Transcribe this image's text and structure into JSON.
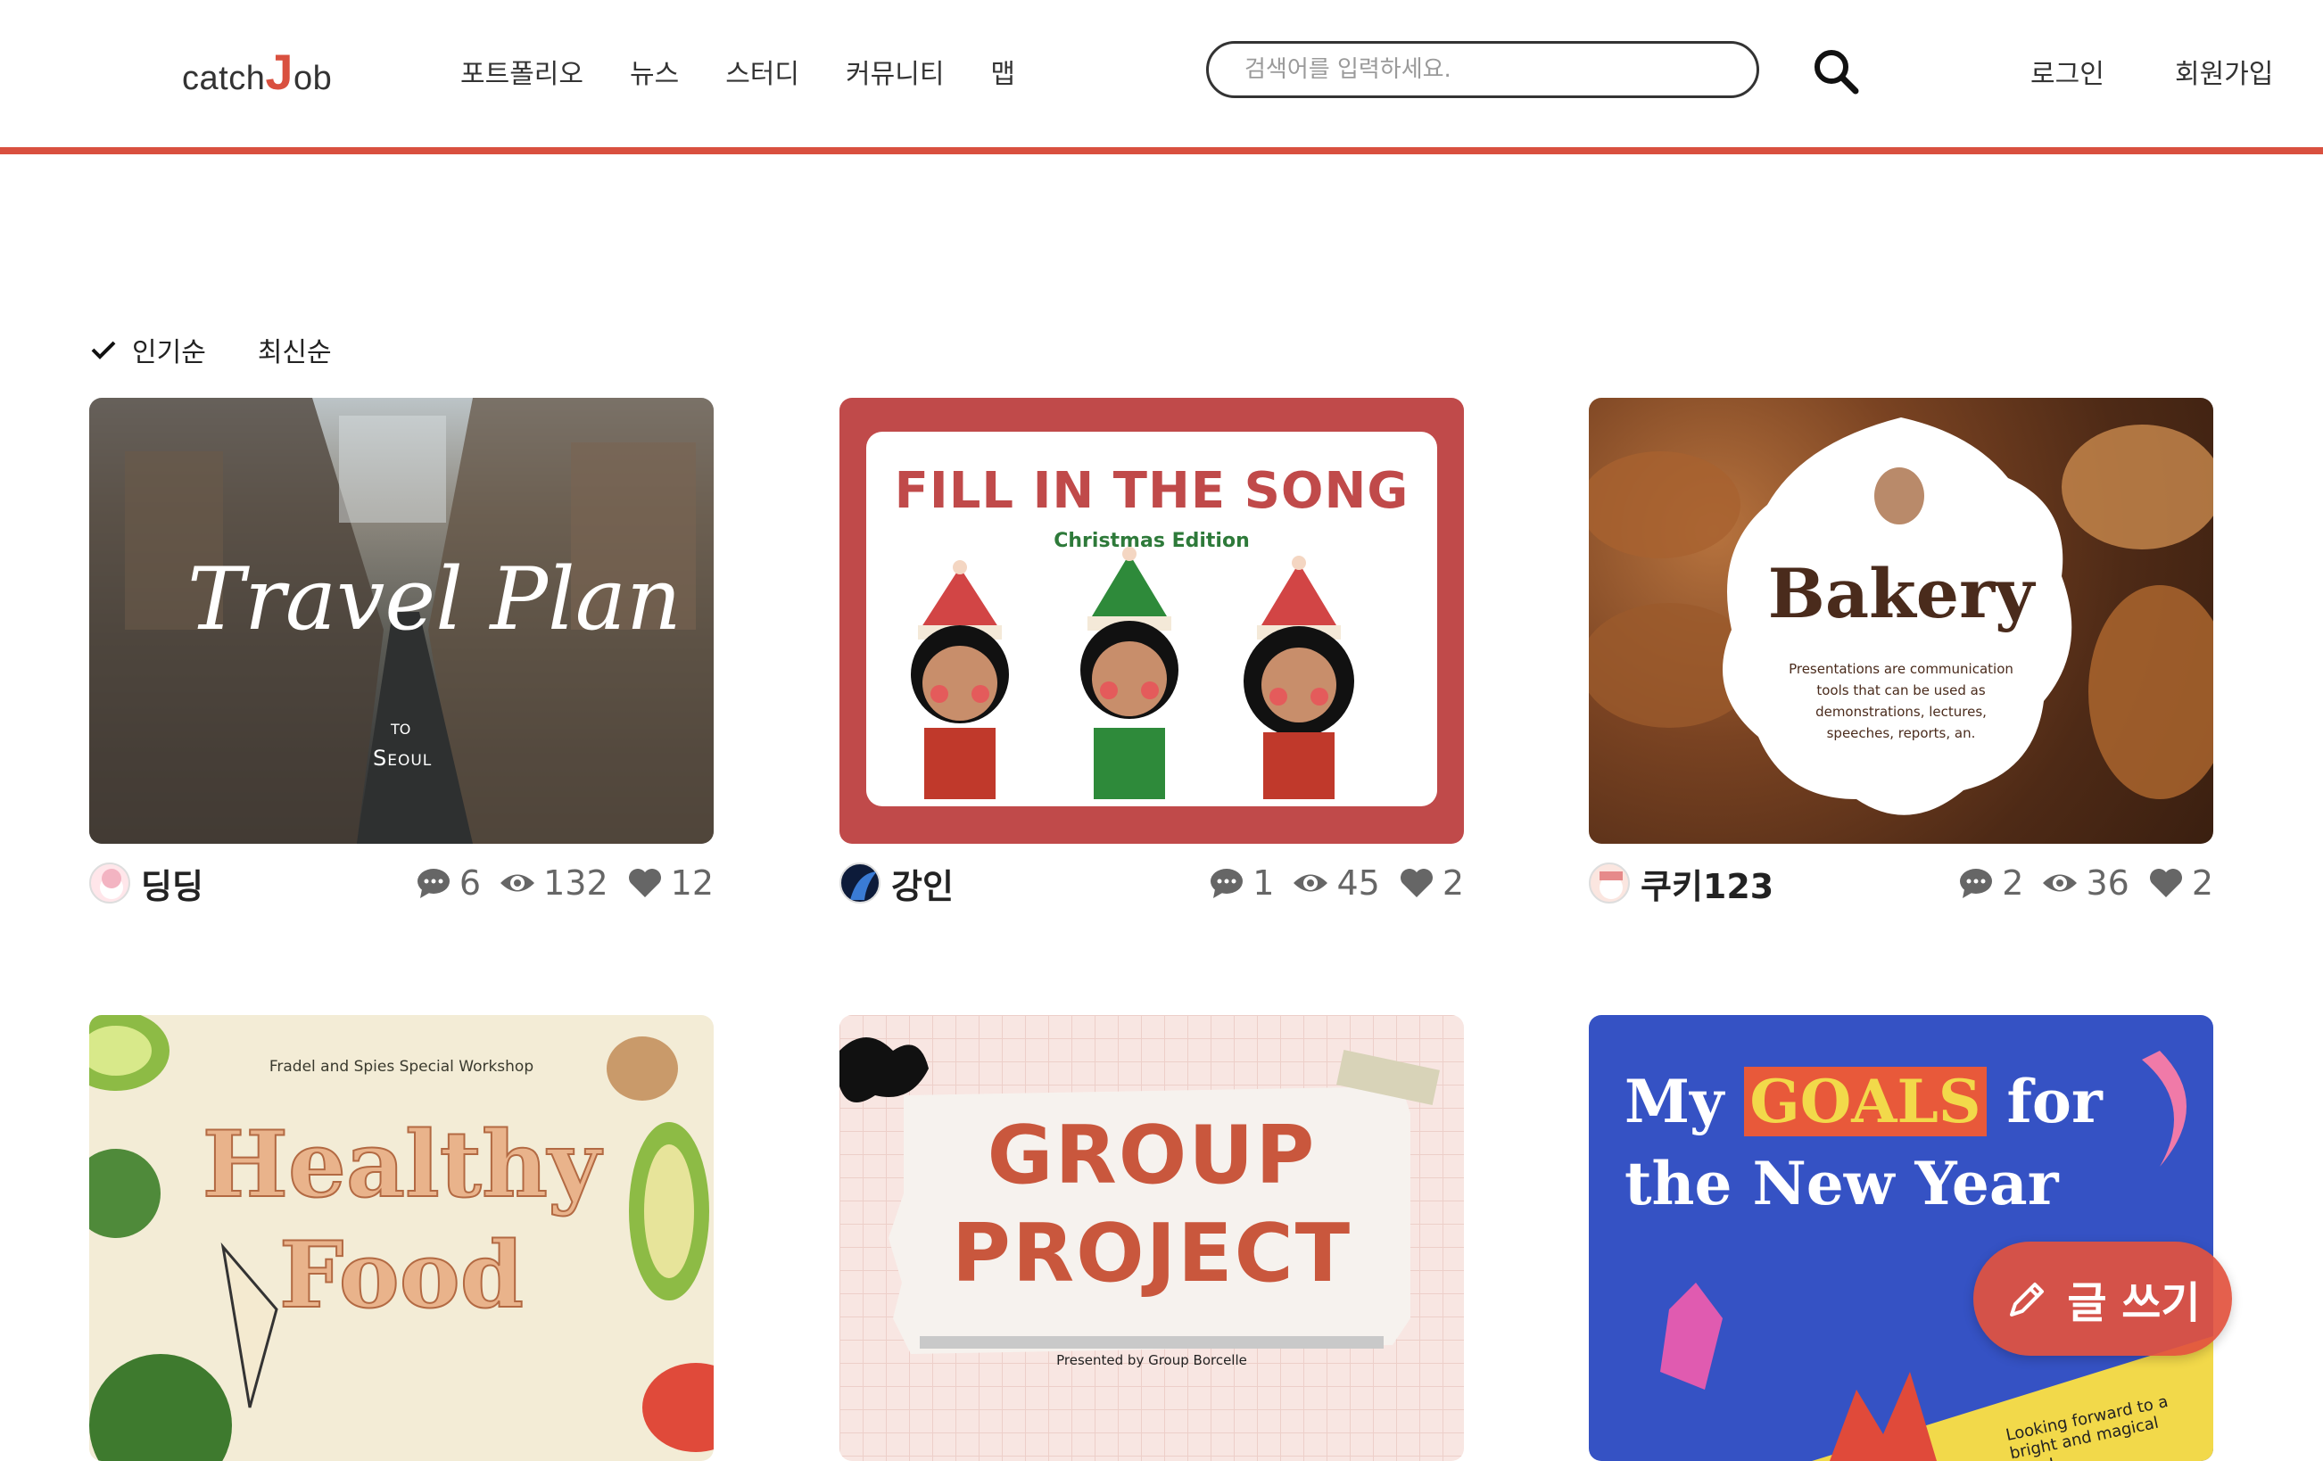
{
  "header": {
    "logo_prefix": "catch",
    "logo_j": "J",
    "logo_suffix": "ob",
    "nav": [
      "포트폴리오",
      "뉴스",
      "스터디",
      "커뮤니티",
      "맵"
    ],
    "search_placeholder": "검색어를 입력하세요.",
    "login": "로그인",
    "signup": "회원가입"
  },
  "sort": {
    "options": [
      "인기순",
      "최신순"
    ],
    "selected": "인기순"
  },
  "cards": [
    {
      "thumb": {
        "script_title": "Travel Plan",
        "to": "TO",
        "place": "Seoul"
      },
      "author": "딩딩",
      "comments": "6",
      "views": "132",
      "likes": "12"
    },
    {
      "thumb": {
        "title": "FILL IN THE SONG",
        "subtitle": "Christmas Edition"
      },
      "author": "강인",
      "comments": "1",
      "views": "45",
      "likes": "2"
    },
    {
      "thumb": {
        "title": "Bakery",
        "body": "Presentations are communication tools that can be used as demonstrations, lectures, speeches, reports, an."
      },
      "author": "쿠키123",
      "comments": "2",
      "views": "36",
      "likes": "2"
    },
    {
      "thumb": {
        "top": "Fradel and Spies Special Workshop",
        "title_1": "Healthy",
        "title_2": "Food"
      }
    },
    {
      "thumb": {
        "title_1": "GROUP",
        "title_2": "PROJECT",
        "footer": "Presented by Group Borcelle"
      }
    },
    {
      "thumb": {
        "line_1a": "My",
        "line_1b": "GOALS",
        "line_1c": "for",
        "line_2": "the New Year",
        "note": "Looking forward to a bright and magical year!"
      }
    }
  ],
  "fab": {
    "label": "글 쓰기"
  },
  "colors": {
    "accent": "#d9503f",
    "stat": "#666666"
  }
}
